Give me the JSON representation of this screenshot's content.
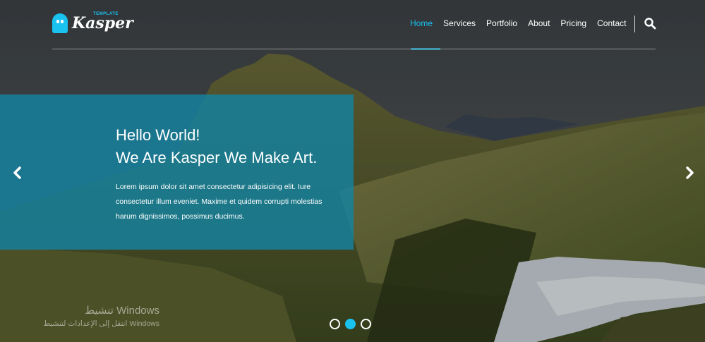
{
  "logo": {
    "small": "TEMPLATE",
    "main": "Kasper"
  },
  "nav": {
    "items": [
      {
        "label": "Home",
        "active": true
      },
      {
        "label": "Services"
      },
      {
        "label": "Portfolio"
      },
      {
        "label": "About"
      },
      {
        "label": "Pricing"
      },
      {
        "label": "Contact"
      }
    ],
    "search_icon": "search-icon"
  },
  "hero": {
    "title_line1": "Hello World!",
    "title_line2": "We Are Kasper We Make Art.",
    "text": "Lorem ipsum dolor sit amet consectetur adipisicing elit. Iure consectetur illum eveniet. Maxime et quidem corrupti molestias harum dignissimos, possimus ducimus."
  },
  "slider": {
    "prev_icon": "chevron-left-icon",
    "next_icon": "chevron-right-icon",
    "bullets": 3,
    "active_bullet": 2
  },
  "watermark": {
    "line1": "تنشيط Windows",
    "line2": "انتقل إلى الإعدادات لتنشيط Windows"
  },
  "colors": {
    "accent": "#19c2ef",
    "hero_box": "#14829f"
  }
}
